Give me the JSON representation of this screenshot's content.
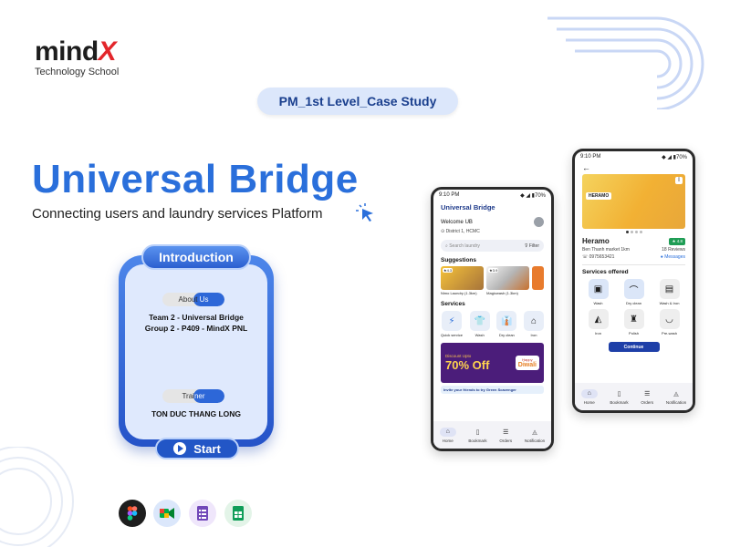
{
  "brand": {
    "word_main": "mind",
    "word_x": "X",
    "tagline": "Technology School"
  },
  "case_label": "PM_1st Level_Case Study",
  "title": "Universal Bridge",
  "subtitle": "Connecting users and laundry services Platform",
  "intro_card": {
    "header": "Introduction",
    "about_left": "About ",
    "about_right": "Us",
    "team_line1": "Team 2 - Universal Bridge",
    "team_line2": "Group 2 - P409 - MindX PNL",
    "trainer_left": "Trai",
    "trainer_right": "ner",
    "trainer_name": "TON DUC THANG LONG",
    "start_label": "Start"
  },
  "tools": [
    "figma-icon",
    "google-meet-icon",
    "google-forms-icon",
    "google-sheets-icon"
  ],
  "colors": {
    "accent": "#2a6fdb",
    "brand_red": "#e3262b",
    "card_blue": "#2553c8"
  },
  "phone_home": {
    "time": "9:10 PM",
    "battery": "70%",
    "app_title": "Universal Bridge",
    "welcome": "Welcome UB",
    "location": "District 1, HCMC",
    "search_placeholder": "Search laundry",
    "filter_label": "Filter",
    "suggestions_label": "Suggestions",
    "suggestions": [
      {
        "name": "Nimo Laundry",
        "dist": "(1.3km)",
        "rating": "4.3"
      },
      {
        "name": "Magicwash",
        "dist": "(1.3km)",
        "rating": "3.9"
      }
    ],
    "services_label": "Services",
    "services": [
      "Quick service",
      "Wash",
      "Dry clean",
      "Iron"
    ],
    "banner_line1": "Discount Upto",
    "banner_big": "70% Off",
    "banner_side1": "Happy",
    "banner_side2": "Diwali",
    "invite_text": "Invite your friends to try Green Scavenger",
    "nav": [
      "Home",
      "Bookmark",
      "Orders",
      "Notification"
    ]
  },
  "phone_detail": {
    "time": "9:10 PM",
    "battery": "70%",
    "shop_name": "Heramo",
    "sign_text": "HERAMO",
    "address": "Ben Thanh market 1km",
    "phone": "0975653421",
    "rating": "4.8",
    "reviews": "18 Reviews",
    "messages": "Messages",
    "services_offered_label": "Services offered",
    "services": [
      "Wash",
      "Dry clean",
      "Wash & Iron",
      "Iron",
      "Polish",
      "Pre-wash"
    ],
    "continue_label": "Continue",
    "nav": [
      "Home",
      "Bookmark",
      "Orders",
      "Notification"
    ]
  }
}
